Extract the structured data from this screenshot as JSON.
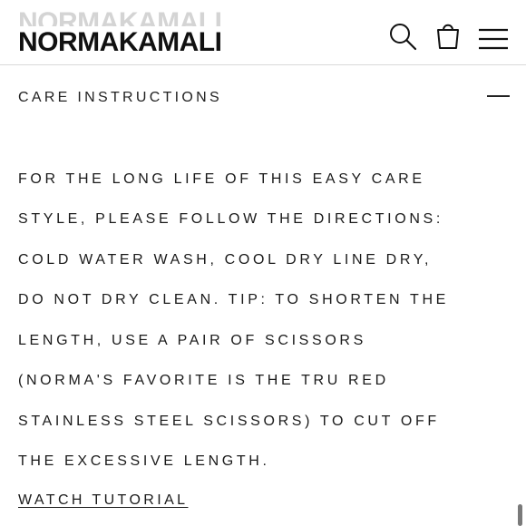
{
  "header": {
    "logo": "NORMAKAMALI",
    "icons": {
      "search": "search-icon",
      "bag": "shopping-bag-icon",
      "menu": "hamburger-menu-icon"
    }
  },
  "section": {
    "title": "CARE INSTRUCTIONS",
    "toggle_icon": "minus-icon",
    "expanded": true
  },
  "care_text": {
    "lines": [
      "FOR THE LONG LIFE OF THIS EASY CARE",
      "STYLE, PLEASE FOLLOW THE DIRECTIONS:",
      "COLD WATER WASH, COOL DRY LINE DRY,",
      "DO NOT DRY CLEAN. TIP: TO SHORTEN THE",
      "LENGTH, USE A PAIR OF SCISSORS",
      "(NORMA'S FAVORITE IS THE TRU RED",
      "STAINLESS STEEL SCISSORS) TO CUT OFF",
      "THE EXCESSIVE LENGTH."
    ]
  },
  "tutorial_link": {
    "label": "WATCH TUTORIAL"
  },
  "colors": {
    "text": "#111111",
    "divider": "#d9d9d9",
    "background": "#ffffff"
  }
}
